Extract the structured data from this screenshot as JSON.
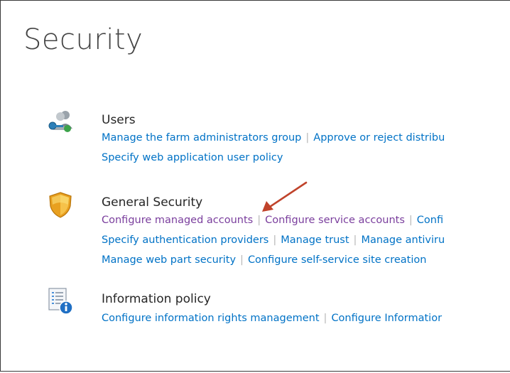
{
  "page": {
    "title": "Security"
  },
  "sections": [
    {
      "heading": "Users",
      "icon": "users-key-icon",
      "lines": [
        [
          "Manage the farm administrators group",
          "Approve or reject distribu"
        ],
        [
          "Specify web application user policy"
        ]
      ]
    },
    {
      "heading": "General Security",
      "icon": "shield-icon",
      "lines": [
        [
          "Configure managed accounts",
          "Configure service accounts",
          "Confi"
        ],
        [
          "Specify authentication providers",
          "Manage trust",
          "Manage antiviru"
        ],
        [
          "Manage web part security",
          "Configure self-service site creation"
        ]
      ]
    },
    {
      "heading": "Information policy",
      "icon": "document-info-icon",
      "lines": [
        [
          "Configure information rights management",
          "Configure Informatior"
        ]
      ]
    }
  ],
  "colors": {
    "link": "#0072c6",
    "visited_link": "#7a3e9d",
    "separator": "#b8b8b8",
    "annotation_arrow": "#c0432b"
  }
}
